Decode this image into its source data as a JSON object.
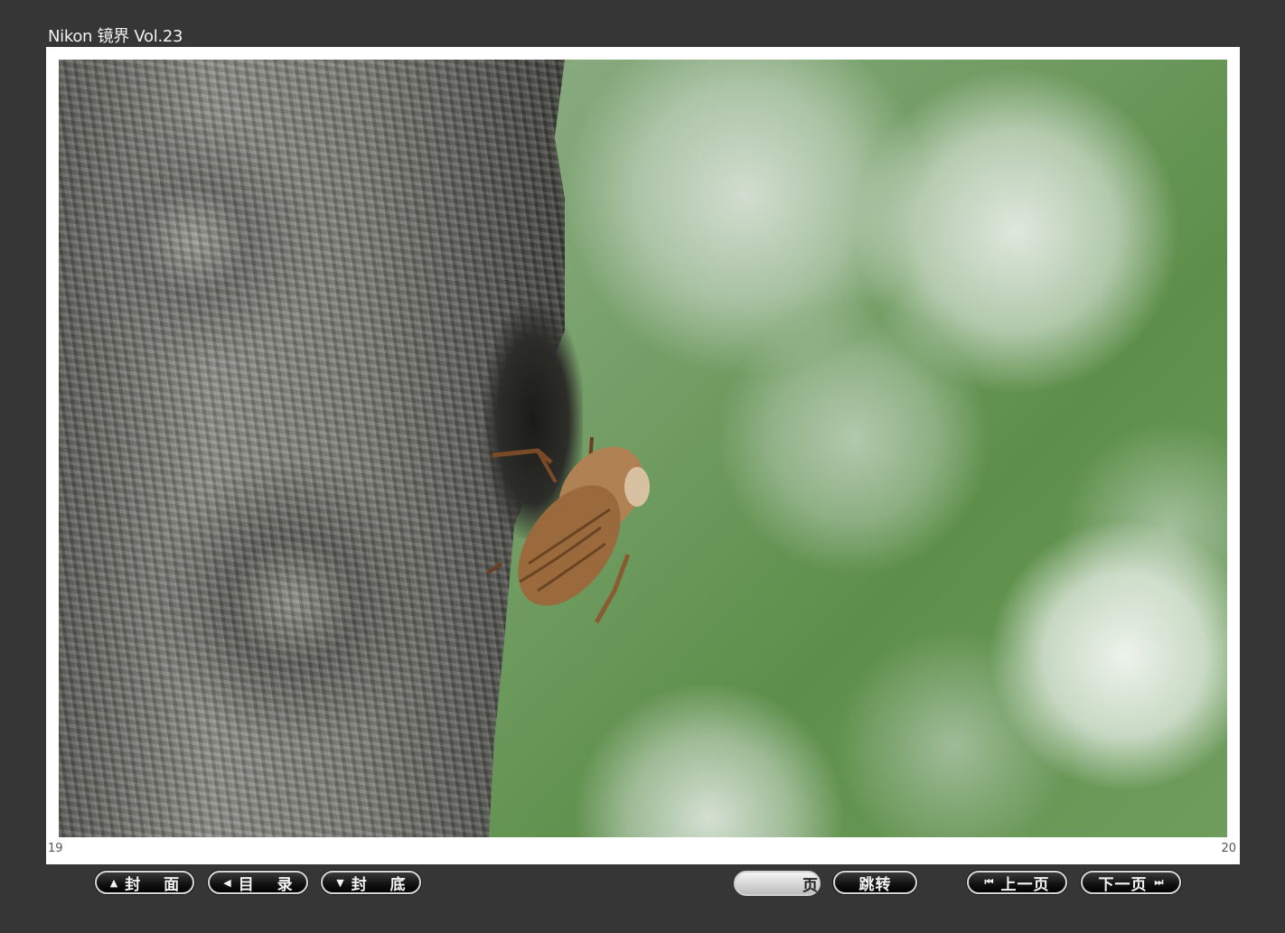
{
  "window": {
    "title": "Nikon 镜界 Vol.23"
  },
  "spread": {
    "left_page": "19",
    "right_page": "20"
  },
  "toolbar": {
    "cover": {
      "label": "封 面",
      "icon": "triangle-up-icon"
    },
    "contents": {
      "label": "目 录",
      "icon": "triangle-left-icon"
    },
    "back_cover": {
      "label": "封 底",
      "icon": "triangle-down-icon"
    },
    "page_input": {
      "value": "",
      "suffix": "页"
    },
    "jump": {
      "label": "跳转"
    },
    "prev": {
      "label": "上一页",
      "icon": "skip-back-icon"
    },
    "next": {
      "label": "下一页",
      "icon": "skip-forward-icon"
    }
  },
  "colors": {
    "background": "#363636",
    "page": "#ffffff",
    "button_border": "#d8d8d8"
  }
}
